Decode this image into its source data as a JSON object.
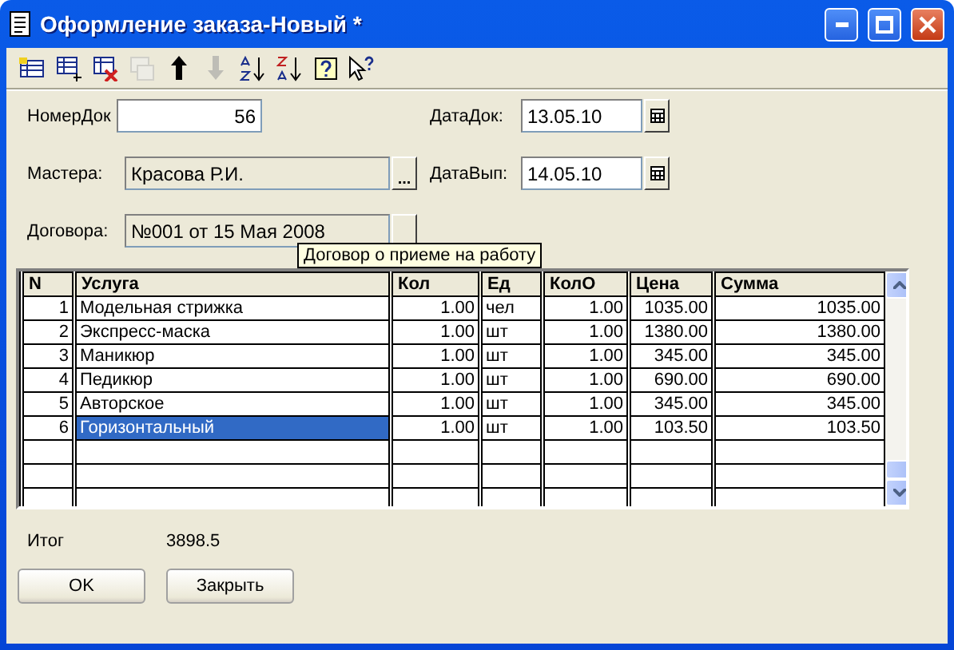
{
  "window": {
    "title": "Оформление заказа-Новый *"
  },
  "toolbar": [
    {
      "kind": "add",
      "disabled": false
    },
    {
      "kind": "add-plus",
      "disabled": false
    },
    {
      "kind": "delete",
      "disabled": false
    },
    {
      "kind": "copy",
      "disabled": true
    },
    {
      "kind": "up",
      "disabled": false
    },
    {
      "kind": "down",
      "disabled": true
    },
    {
      "kind": "sort-asc",
      "disabled": false
    },
    {
      "kind": "sort-desc",
      "disabled": false
    },
    {
      "kind": "help",
      "disabled": false
    },
    {
      "kind": "pointer-help",
      "disabled": false
    }
  ],
  "form": {
    "doc_number": {
      "label": "НомерДок",
      "value": "56"
    },
    "doc_date": {
      "label": "ДатаДок:",
      "value": "13.05.10"
    },
    "masters": {
      "label": "Мастера:",
      "value": "Красова Р.И.",
      "button": "..."
    },
    "issue_date": {
      "label": "ДатаВып:",
      "value": "14.05.10"
    },
    "contract": {
      "label": "Договора:",
      "value": "№001 от 15 Мая 2008"
    }
  },
  "tooltip": "Договор о приеме на работу",
  "table": {
    "columns": [
      "N",
      "Услуга",
      "Кол",
      "Ед",
      "КолО",
      "Цена",
      "Сумма"
    ],
    "rows": [
      {
        "cells": [
          "1",
          "Модельная стрижка",
          "1.00",
          "чел",
          "1.00",
          "1035.00",
          "1035.00"
        ],
        "selected": false
      },
      {
        "cells": [
          "2",
          "Экспресс-маска",
          "1.00",
          "шт",
          "1.00",
          "1380.00",
          "1380.00"
        ],
        "selected": false
      },
      {
        "cells": [
          "3",
          "Маникюр",
          "1.00",
          "шт",
          "1.00",
          "345.00",
          "345.00"
        ],
        "selected": false
      },
      {
        "cells": [
          "4",
          "Педикюр",
          "1.00",
          "шт",
          "1.00",
          "690.00",
          "690.00"
        ],
        "selected": false
      },
      {
        "cells": [
          "5",
          "Авторское",
          "1.00",
          "шт",
          "1.00",
          "345.00",
          "345.00"
        ],
        "selected": false
      },
      {
        "cells": [
          "6",
          "Горизонтальный",
          "1.00",
          "шт",
          "1.00",
          "103.50",
          "103.50"
        ],
        "selected": true
      }
    ]
  },
  "total": {
    "label": "Итог",
    "value": "3898.5"
  },
  "buttons": [
    "OK",
    "Закрыть"
  ]
}
